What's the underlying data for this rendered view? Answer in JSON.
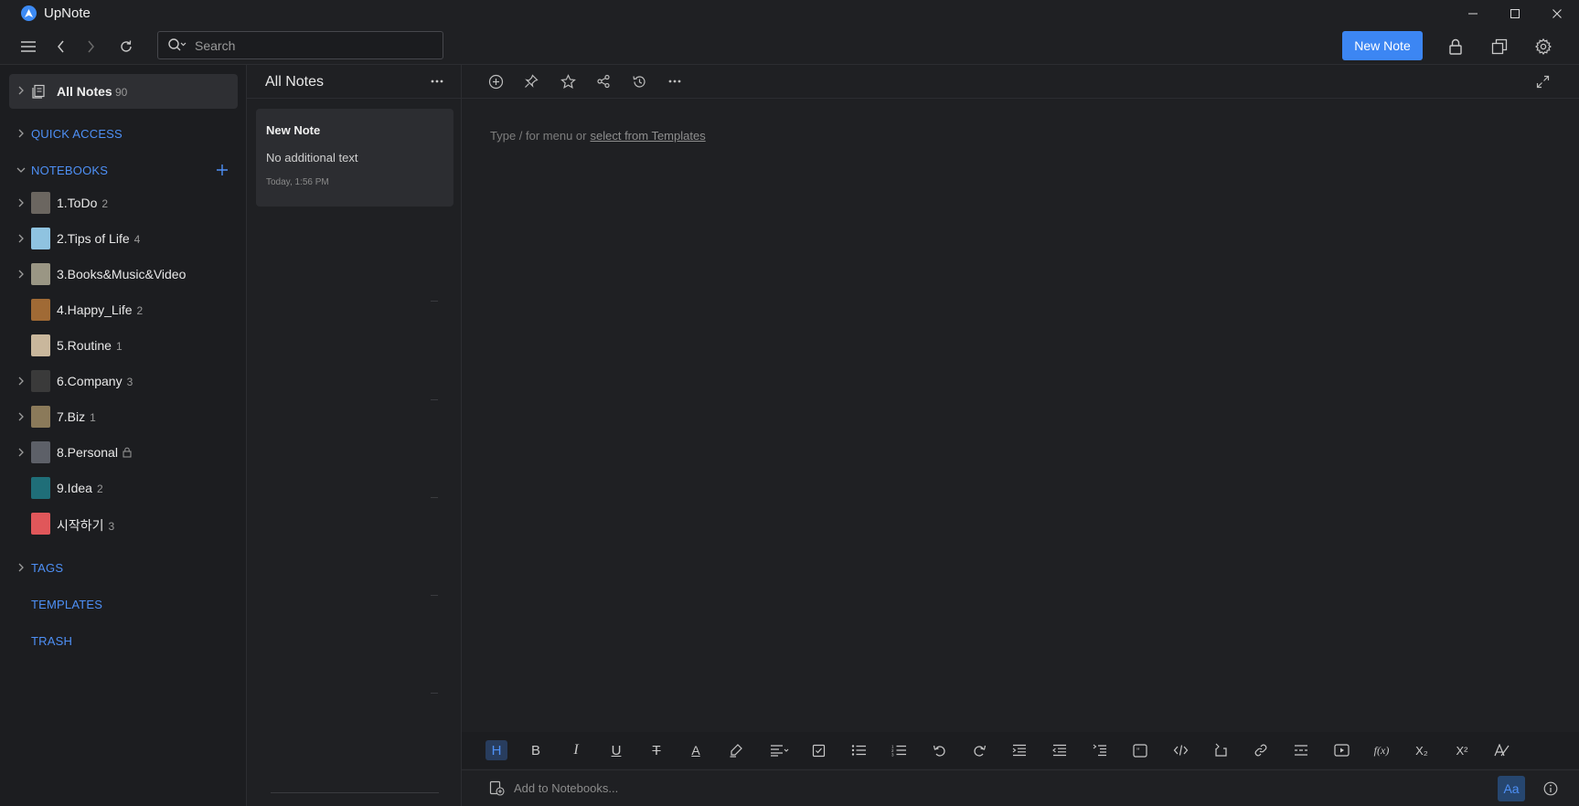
{
  "app": {
    "title": "UpNote"
  },
  "toolbar": {
    "search_placeholder": "Search",
    "new_note_label": "New Note"
  },
  "sidebar": {
    "all_notes": {
      "label": "All Notes",
      "count": "90"
    },
    "quick_access": "QUICK ACCESS",
    "notebooks_label": "NOTEBOOKS",
    "notebooks": [
      {
        "name": "1.ToDo",
        "count": "2",
        "expandable": true,
        "color": "#6b6660"
      },
      {
        "name": "2.Tips of Life",
        "count": "4",
        "expandable": true,
        "color": "#8fc3e0"
      },
      {
        "name": "3.Books&Music&Video",
        "count": "",
        "expandable": true,
        "color": "#9a9684"
      },
      {
        "name": "4.Happy_Life",
        "count": "2",
        "expandable": false,
        "color": "#a06a35"
      },
      {
        "name": "5.Routine",
        "count": "1",
        "expandable": false,
        "color": "#c9b79c"
      },
      {
        "name": "6.Company",
        "count": "3",
        "expandable": true,
        "color": "#3a3a3a"
      },
      {
        "name": "7.Biz",
        "count": "1",
        "expandable": true,
        "color": "#8b7a5a"
      },
      {
        "name": "8.Personal",
        "count": "",
        "expandable": true,
        "locked": true,
        "color": "#5d6068"
      },
      {
        "name": "9.Idea",
        "count": "2",
        "expandable": false,
        "color": "#1f6e78"
      },
      {
        "name": "시작하기",
        "count": "3",
        "expandable": false,
        "color": "#e0575a"
      }
    ],
    "tags": "TAGS",
    "templates": "TEMPLATES",
    "trash": "TRASH"
  },
  "note_list": {
    "title": "All Notes",
    "notes": [
      {
        "title": "New Note",
        "snippet": "No additional text",
        "date": "Today, 1:56 PM"
      }
    ]
  },
  "editor": {
    "placeholder_prefix": "Type / for menu or",
    "placeholder_link": "select from Templates",
    "add_to_notebooks": "Add to Notebooks...",
    "font_button": "Aa",
    "format_heading": "H",
    "format_bold": "B",
    "format_italic": "I",
    "format_underline": "U",
    "format_strike": "T",
    "format_color": "A",
    "format_subscript": "X₂",
    "format_superscript": "X²",
    "format_function": "f(x)"
  }
}
